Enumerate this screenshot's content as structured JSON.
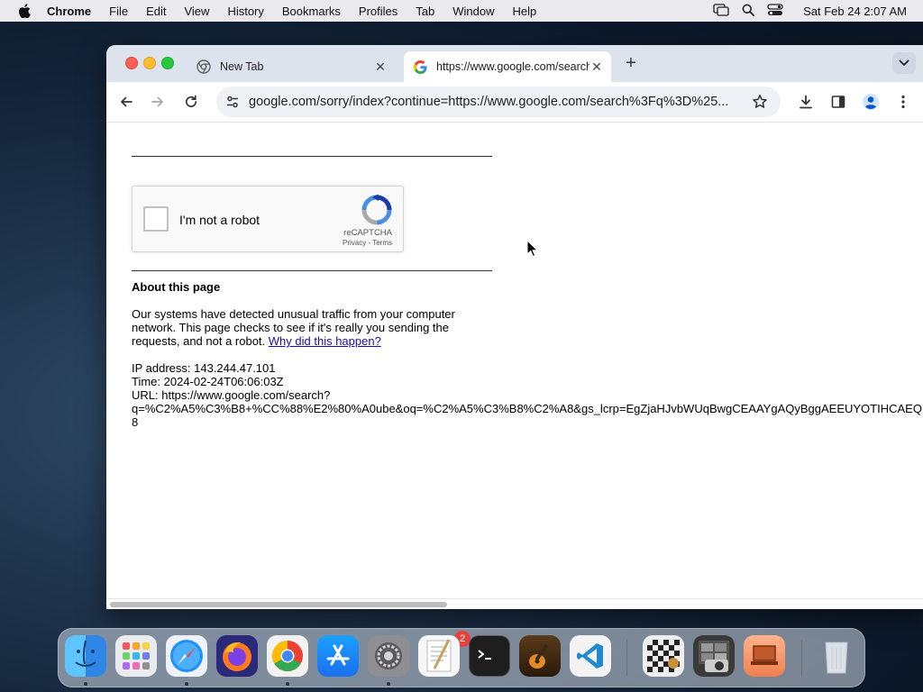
{
  "menubar": {
    "app_name": "Chrome",
    "items": [
      "File",
      "Edit",
      "View",
      "History",
      "Bookmarks",
      "Profiles",
      "Tab",
      "Window",
      "Help"
    ],
    "clock": "Sat Feb 24  2:07 AM"
  },
  "tabs": [
    {
      "title": "New Tab",
      "active": false
    },
    {
      "title": "https://www.google.com/search",
      "active": true
    }
  ],
  "omnibox": {
    "url": "google.com/sorry/index?continue=https://www.google.com/search%3Fq%3D%25..."
  },
  "page": {
    "captcha": {
      "label": "I'm not a robot",
      "brand": "reCAPTCHA",
      "privacy": "Privacy",
      "separator": " - ",
      "terms": "Terms"
    },
    "about_title": "About this page",
    "paragraph": "Our systems have detected unusual traffic from your computer network. This page checks to see if it's really you sending the requests, and not a robot.",
    "why_link": "Why did this happen?",
    "ip_line": "IP address: 143.244.47.101",
    "time_line": "Time: 2024-02-24T06:06:03Z",
    "url_line1": "URL: https://www.google.com/search?",
    "url_line2": "q=%C2%A5%C3%B8+%CC%88%E2%80%A0ube&oq=%C2%A5%C3%B8%C2%A8&gs_lcrp=EgZjaHJvbWUqBwgCEAAYgAQyBggAEEUYOTIHCAEQ",
    "url_line3": "8"
  },
  "dock": {
    "badge_count": "2",
    "apps": [
      "Finder",
      "Launchpad",
      "Safari",
      "Firefox",
      "Chrome",
      "App Store",
      "System Settings",
      "TextEdit",
      "Terminal",
      "GarageBand",
      "Visual Studio Code",
      "Chess",
      "Photo Booth",
      "Remote Desktop",
      "Trash"
    ]
  },
  "colors": {
    "link": "#1a0dab",
    "tabstrip": "#dde3ec",
    "omnibox": "#eef1f6"
  }
}
